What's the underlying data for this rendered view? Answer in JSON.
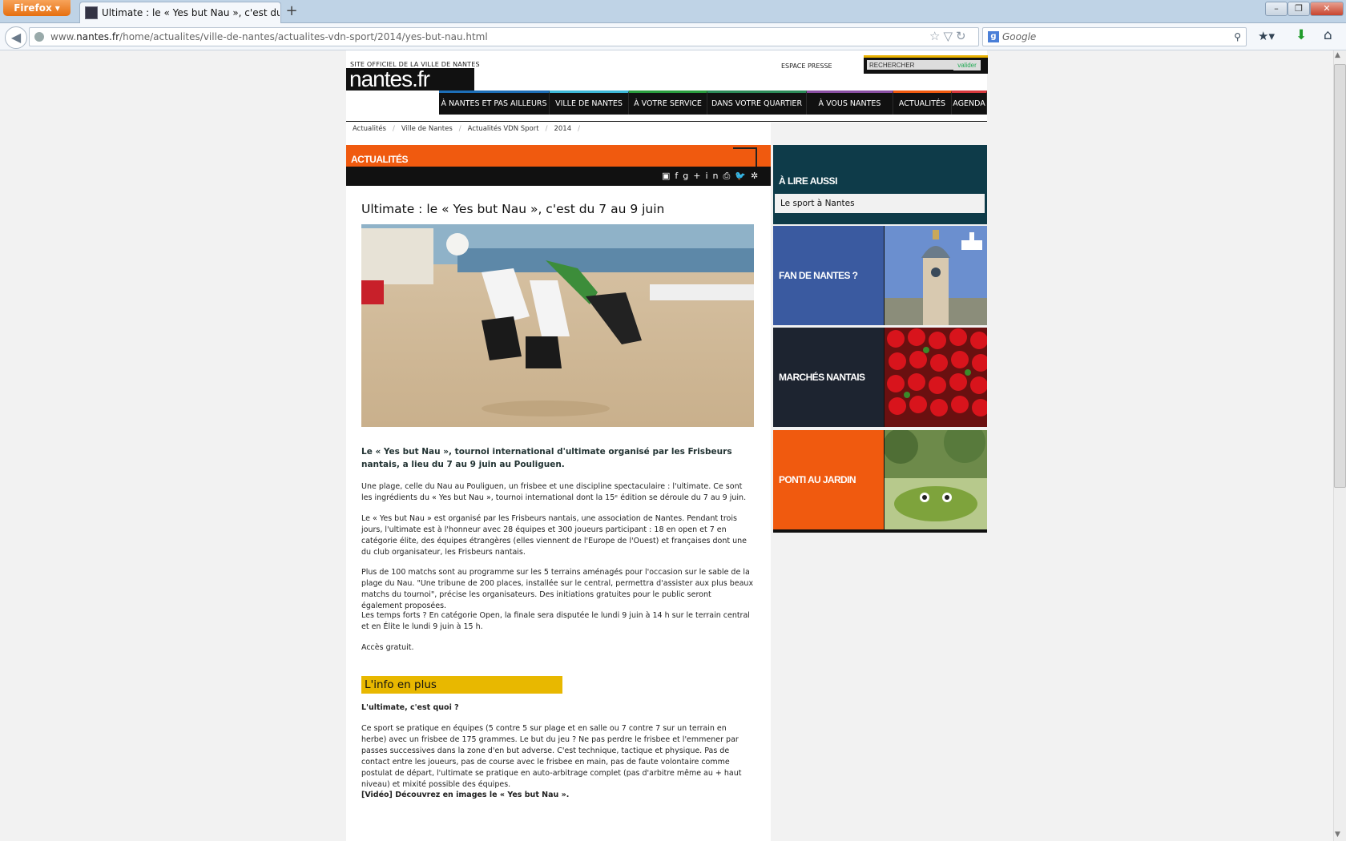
{
  "browser": {
    "menu_label": "Firefox",
    "tab_title": "Ultimate : le « Yes but Nau », c'est du 7 a...",
    "new_tab": "+",
    "url_prefix": "www.",
    "url_domain": "nantes.fr",
    "url_path": "/home/actualites/ville-de-nantes/actualites-vdn-sport/2014/yes-but-nau.html",
    "search_placeholder": "Google"
  },
  "site": {
    "tagline": "SITE OFFICIEL DE LA VILLE DE NANTES",
    "logo": "nantes.fr",
    "espace_presse": "ESPACE PRESSE",
    "search_placeholder": "RECHERCHER",
    "search_button": "valider",
    "nav": [
      {
        "label": "À NANTES ET PAS AILLEURS",
        "color": "#1d6fb8"
      },
      {
        "label": "VILLE DE NANTES",
        "color": "#3cb8d8"
      },
      {
        "label": "À VOTRE SERVICE",
        "color": "#2a9d3e"
      },
      {
        "label": "DANS VOTRE QUARTIER",
        "color": "#2c8b59"
      },
      {
        "label": "À VOUS NANTES",
        "color": "#8a4fa3"
      },
      {
        "label": "ACTUALITÉS",
        "color": "#f05a0f"
      },
      {
        "label": "AGENDA",
        "color": "#d8383c"
      }
    ],
    "breadcrumb": [
      "Actualités",
      "Ville de Nantes",
      "Actualités VDN Sport",
      "2014"
    ]
  },
  "article": {
    "section": "ACTUALITÉS",
    "title": "Ultimate : le « Yes but Nau », c'est du 7 au 9 juin",
    "lead": "Le « Yes but Nau », tournoi international d'ultimate organisé par les Frisbeurs nantais, a lieu du 7 au 9 juin au Pouliguen.",
    "p1": "Une plage, celle du Nau au Pouliguen, un frisbee et une discipline spectaculaire : l'ultimate. Ce sont les ingrédients du « Yes but Nau », tournoi international dont la 15ᵉ édition se déroule du 7 au 9 juin.",
    "p2": "Le « Yes but Nau » est organisé par les Frisbeurs nantais, une association de Nantes. Pendant trois jours, l'ultimate est à l'honneur avec 28 équipes et 300 joueurs participant : 18 en open et 7 en catégorie élite, des équipes étrangères (elles viennent de l'Europe de l'Ouest) et françaises dont une du club organisateur, les Frisbeurs nantais.",
    "p3": "Plus de 100 matchs sont au programme sur les 5 terrains aménagés pour l'occasion sur le sable de la plage du Nau. \"Une tribune de 200 places, installée sur le central, permettra d'assister aux plus beaux matchs du tournoi\", précise les organisateurs. Des initiations gratuites pour le public seront également proposées.",
    "p4": "Les temps forts ? En catégorie Open, la finale sera disputée le lundi 9 juin à 14 h sur le terrain central et en Élite le lundi 9 juin à 15 h.",
    "p5": "Accès gratuit.",
    "info_title": "L'info en plus",
    "p6": "L'ultimate, c'est quoi ?",
    "p7": "Ce sport se pratique en équipes (5 contre 5 sur plage et en salle ou 7 contre 7 sur un terrain en herbe) avec un frisbee de 175 grammes. Le but du jeu ? Ne pas perdre le frisbee et l'emmener par passes successives dans la zone d'en but adverse. C'est technique, tactique et physique. Pas de contact entre les joueurs, pas de course avec le frisbee en main, pas de faute volontaire comme postulat de départ, l'ultimate se pratique en auto-arbitrage complet (pas d'arbitre même au + haut niveau) et mixité possible des équipes.",
    "p8": "[Vidéo] Découvrez en images le « Yes but Nau »."
  },
  "sidebar": {
    "lire_title": "À LIRE AUSSI",
    "lire_link": "Le sport à Nantes",
    "tiles": [
      {
        "label": "FAN DE NANTES ?",
        "color": "#3a5aa0"
      },
      {
        "label": "MARCHÉS NANTAIS",
        "color": "#1d2430"
      },
      {
        "label": "PONTI AU JARDIN",
        "color": "#f05a0f"
      }
    ]
  }
}
